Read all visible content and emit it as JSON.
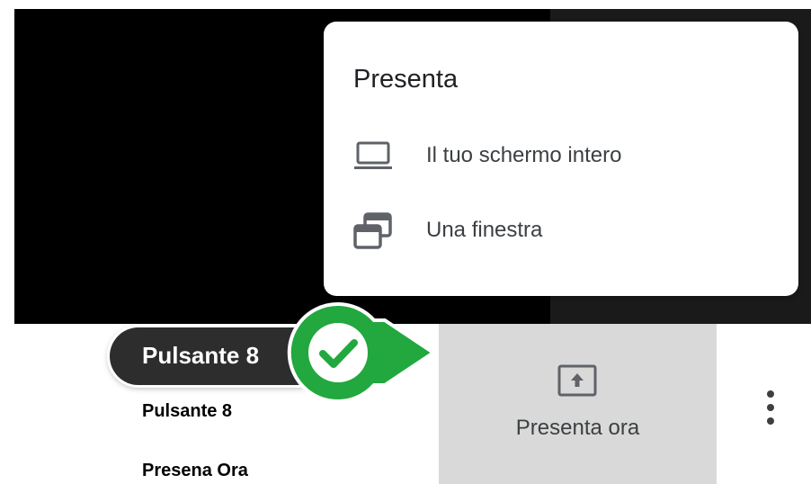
{
  "present_menu": {
    "title": "Presenta",
    "items": [
      {
        "label": "Il tuo schermo intero",
        "icon": "laptop-icon"
      },
      {
        "label": "Una finestra",
        "icon": "window-icon"
      }
    ]
  },
  "present_panel": {
    "label": "Presenta ora",
    "icon": "present-to-all-icon"
  },
  "more_options": {
    "icon": "more-vert-icon"
  },
  "annotation": {
    "callout_label": "Pulsante 8",
    "caption_1": "Pulsante 8",
    "caption_2": "Presena Ora",
    "accent_color": "#22a83e"
  }
}
